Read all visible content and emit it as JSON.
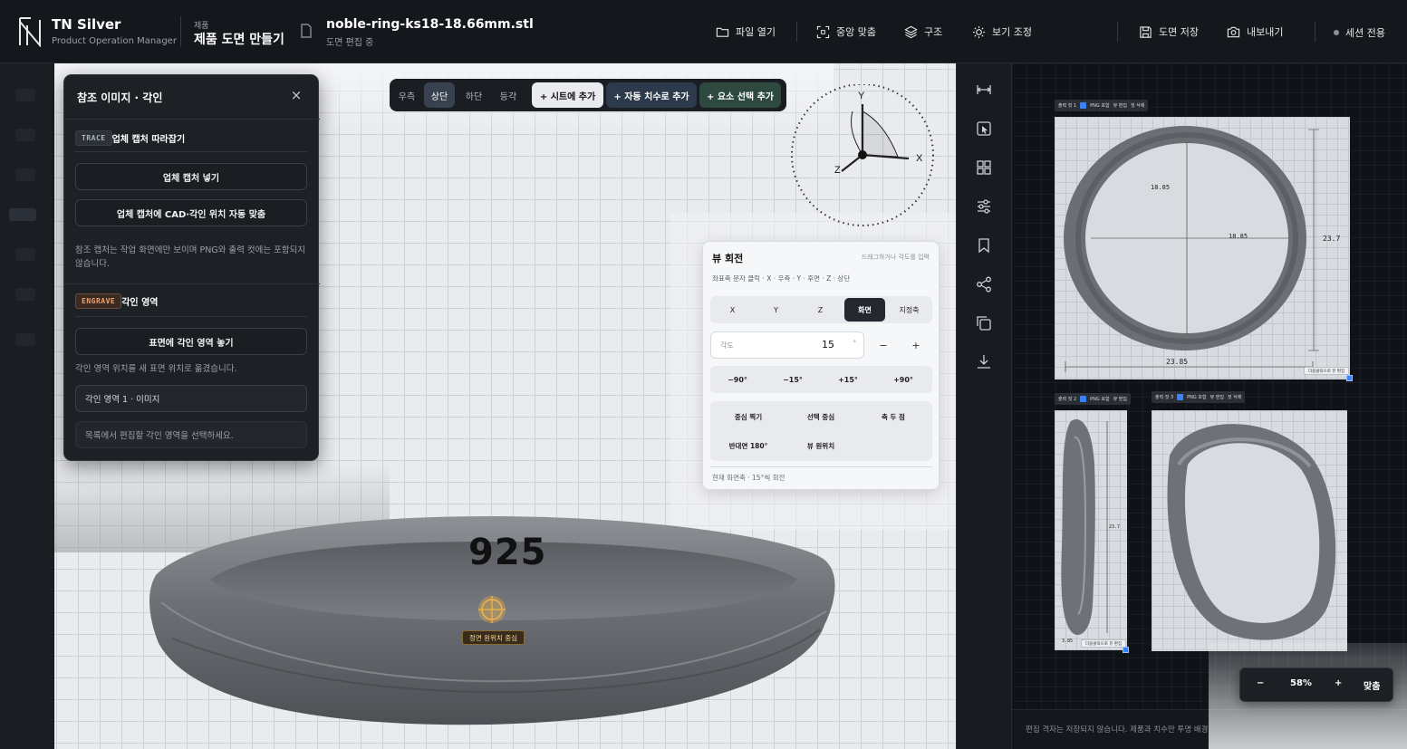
{
  "brand": {
    "name": "TN Silver",
    "subtitle": "Product Operation Manager"
  },
  "breadcrumb": {
    "section": "제품",
    "title": "제품 도면 만들기"
  },
  "file": {
    "name": "noble-ring-ks18-18.66mm.stl",
    "status": "도면 편집 중"
  },
  "toolbar": {
    "open_file": "파일 열기",
    "center_align": "중앙 맞춤",
    "structure": "구조",
    "view_adjust": "보기 조정",
    "save_drawing": "도면 저장",
    "export": "내보내기",
    "session": "세션 전용"
  },
  "view_tabs": {
    "right": "우측",
    "top": "상단",
    "bottom": "하단",
    "iso": "등각",
    "add_sheet": "+ 시트에 추가",
    "auto_dim": "+ 자동 치수로 추가",
    "add_selected": "+ 요소 선택 추가"
  },
  "gizmo": {
    "y": "Y",
    "x": "X",
    "z": "Z"
  },
  "ref_panel": {
    "title": "참조 이미지 · 각인",
    "trace_tag": "TRACE",
    "trace_label": "업체 캡처 따라잡기",
    "insert_capture": "업체 캡처 넣기",
    "auto_fit": "업체 캡처에 CAD·각인 위치 자동 맞춤",
    "trace_note": "참조 캡처는 작업 화면에만 보이며 PNG와 출력 컷에는 포함되지 않습니다.",
    "engrave_tag": "ENGRAVE",
    "engrave_label": "각인 영역",
    "place_area": "표면에 각인 영역 놓기",
    "engrave_note": "각인 영역 위치를 새 표면 위치로 옮겼습니다.",
    "area_item": "각인 영역 1 · 이미지",
    "select_hint": "목록에서 편집할 각인 영역을 선택하세요."
  },
  "rotation": {
    "title": "뷰 회전",
    "hint": "드래그하거나 각도를 입력",
    "axis_help": "좌표축 문자 클릭 · X · 우측 · Y · 후면 · Z · 상단",
    "axes": [
      "X",
      "Y",
      "Z",
      "화면",
      "지정축"
    ],
    "active_axis": "화면",
    "angle_label": "각도",
    "angle_value": "15",
    "angle_unit": "°",
    "minus": "−",
    "plus": "+",
    "presets": [
      "−90°",
      "−15°",
      "+15°",
      "+90°"
    ],
    "actions": [
      "중심 찍기",
      "선택 중심",
      "축 두 점",
      "반대면 180°",
      "뷰 원위치"
    ],
    "status": "현재 화면축 · 15°씩 회전"
  },
  "model": {
    "stamp": "925",
    "center_label": "정면 원위치 중심"
  },
  "sheet": {
    "cuts": [
      {
        "label": "출력 컷 1",
        "png": "PNG 포함",
        "edit": "뷰 편집",
        "delete": "컷 삭제"
      },
      {
        "label": "출력 컷 2",
        "png": "PNG 포함",
        "edit": "뷰 편집"
      },
      {
        "label": "출력 컷 3",
        "png": "PNG 포함",
        "edit": "뷰 편집",
        "delete": "컷 삭제"
      }
    ],
    "dims": {
      "inner_w": "18.85",
      "inner_h": "18.85",
      "outer_w": "23.85",
      "outer_h": "23.7",
      "side_h": "23.7",
      "side_w": "3.85"
    },
    "cut_tag": "더블클릭으로 뷰 편집",
    "footer": "편집 격자는 저장되지 않습니다. 제품과 치수만 투명 배경"
  },
  "zoom": {
    "minus": "−",
    "level": "58%",
    "plus": "+",
    "fit": "맞춤"
  }
}
